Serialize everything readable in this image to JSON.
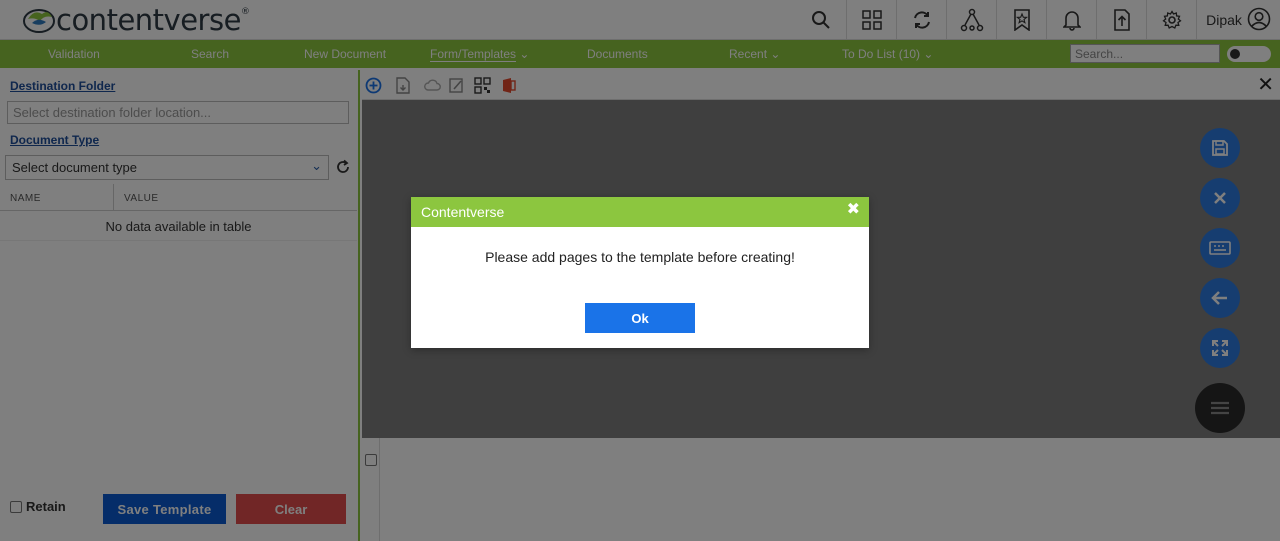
{
  "header": {
    "logo_text": "contentverse",
    "logo_mark": "®",
    "icons": [
      "search-icon",
      "grid-icon",
      "sync-icon",
      "workflow-icon",
      "bookmark-star-icon",
      "bell-icon",
      "upload-file-icon",
      "gear-icon"
    ],
    "user_name": "Dipak"
  },
  "nav": {
    "items": [
      {
        "label": "Validation"
      },
      {
        "label": "Search"
      },
      {
        "label": "New Document"
      },
      {
        "label": "Form/Templates"
      },
      {
        "label": "Documents"
      },
      {
        "label": "Recent"
      },
      {
        "label": "To Do List",
        "count": "(10)"
      }
    ],
    "search_placeholder": "Search..."
  },
  "left_panel": {
    "destination_label": "Destination Folder",
    "destination_placeholder": "Select destination folder location...",
    "doctype_label": "Document Type",
    "doctype_selected": "Select document type",
    "table": {
      "columns": [
        "NAME",
        "VALUE"
      ],
      "empty_text": "No data available in table"
    },
    "retain_label": "Retain",
    "save_label": "Save Template",
    "clear_label": "Clear"
  },
  "viewer": {
    "fab_icons": [
      "save-icon",
      "cancel-icon",
      "keyboard-icon",
      "back-arrow-icon",
      "expand-icon",
      "menu-icon"
    ]
  },
  "modal": {
    "title": "Contentverse",
    "close_symbol": "✖",
    "message": "Please add pages to the template before creating!",
    "ok_label": "Ok"
  },
  "colors": {
    "brand_green": "#8cc63f",
    "primary_blue": "#1a73e8",
    "danger_red": "#e24c4c"
  }
}
